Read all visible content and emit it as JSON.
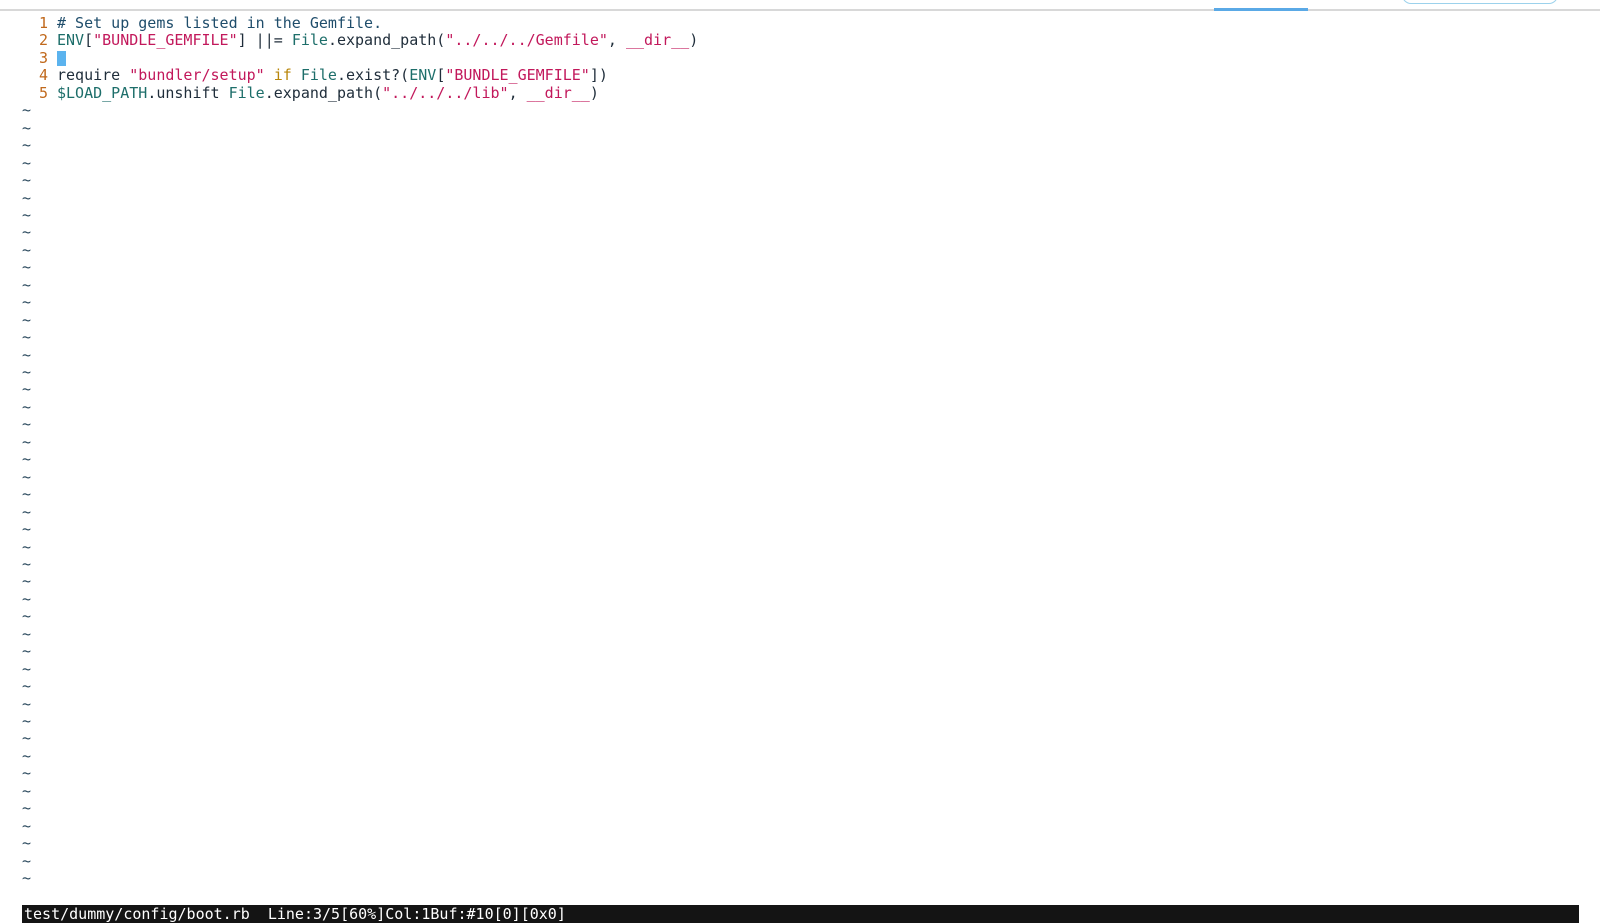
{
  "editor": {
    "lines": [
      {
        "number": "1",
        "tokens": [
          {
            "type": "comment",
            "text": "# Set up gems listed in the Gemfile."
          }
        ]
      },
      {
        "number": "2",
        "tokens": [
          {
            "type": "const",
            "text": "ENV"
          },
          {
            "type": "plain",
            "text": "["
          },
          {
            "type": "string",
            "text": "\"BUNDLE_GEMFILE\""
          },
          {
            "type": "plain",
            "text": "] ||= "
          },
          {
            "type": "const",
            "text": "File"
          },
          {
            "type": "plain",
            "text": ".expand_path("
          },
          {
            "type": "string",
            "text": "\"../../../Gemfile\""
          },
          {
            "type": "plain",
            "text": ", "
          },
          {
            "type": "string",
            "text": "__dir__"
          },
          {
            "type": "plain",
            "text": ")"
          }
        ]
      },
      {
        "number": "3",
        "tokens": [],
        "cursor": true
      },
      {
        "number": "4",
        "tokens": [
          {
            "type": "plain",
            "text": "require "
          },
          {
            "type": "string",
            "text": "\"bundler/setup\""
          },
          {
            "type": "plain",
            "text": " "
          },
          {
            "type": "keyword",
            "text": "if"
          },
          {
            "type": "plain",
            "text": " "
          },
          {
            "type": "const",
            "text": "File"
          },
          {
            "type": "plain",
            "text": ".exist?("
          },
          {
            "type": "const",
            "text": "ENV"
          },
          {
            "type": "plain",
            "text": "["
          },
          {
            "type": "string",
            "text": "\"BUNDLE_GEMFILE\""
          },
          {
            "type": "plain",
            "text": "])"
          }
        ]
      },
      {
        "number": "5",
        "tokens": [
          {
            "type": "global",
            "text": "$LOAD_PATH"
          },
          {
            "type": "plain",
            "text": ".unshift "
          },
          {
            "type": "const",
            "text": "File"
          },
          {
            "type": "plain",
            "text": ".expand_path("
          },
          {
            "type": "string",
            "text": "\"../../../lib\""
          },
          {
            "type": "plain",
            "text": ", "
          },
          {
            "type": "string",
            "text": "__dir__"
          },
          {
            "type": "plain",
            "text": ")"
          }
        ]
      }
    ],
    "tilde_char": "~",
    "tilde_count": 45
  },
  "statusbar": {
    "text": "test/dummy/config/boot.rb  Line:3/5[60%]Col:1Buf:#10[0][0x0]"
  },
  "colors": {
    "line_number": "#c0681b",
    "string": "#c2185b",
    "keyword": "#b8860b",
    "const": "#1d6e6a",
    "cursor": "#5bb3ee",
    "statusbar_bg": "#141414"
  }
}
